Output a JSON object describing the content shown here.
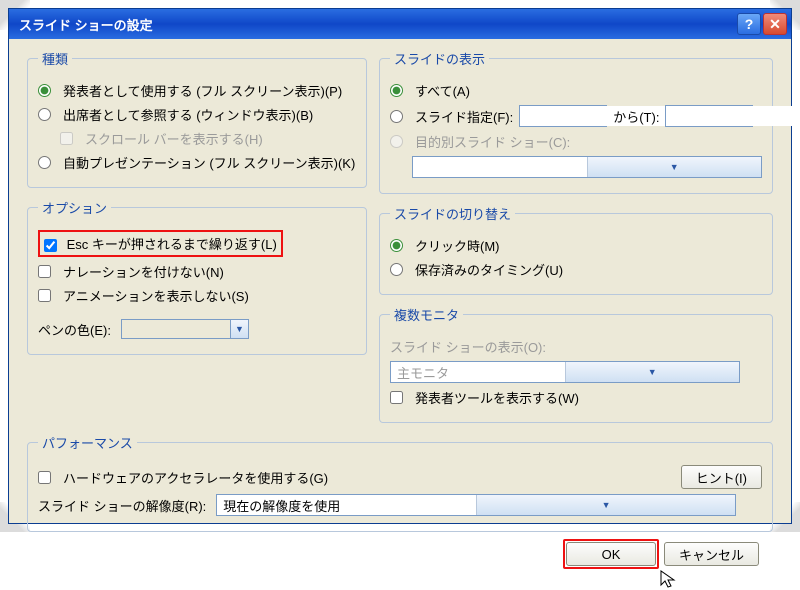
{
  "title": "スライド ショーの設定",
  "type_group": {
    "legend": "種類",
    "presenter": "発表者として使用する (フル スクリーン表示)(P)",
    "attendee": "出席者として参照する (ウィンドウ表示)(B)",
    "scroll": "スクロール バーを表示する(H)",
    "auto": "自動プレゼンテーション (フル スクリーン表示)(K)"
  },
  "options_group": {
    "legend": "オプション",
    "loop": "Esc キーが押されるまで繰り返す(L)",
    "no_narration": "ナレーションを付けない(N)",
    "no_animation": "アニメーションを表示しない(S)",
    "pen_color_label": "ペンの色(E):"
  },
  "slides_group": {
    "legend": "スライドの表示",
    "all": "すべて(A)",
    "range": "スライド指定(F):",
    "from_value": "",
    "to_label": "から(T):",
    "to_value": "",
    "custom": "目的別スライド ショー(C):",
    "custom_value": ""
  },
  "advance_group": {
    "legend": "スライドの切り替え",
    "manual": "クリック時(M)",
    "timings": "保存済みのタイミング(U)"
  },
  "monitors_group": {
    "legend": "複数モニタ",
    "display_label": "スライド ショーの表示(O):",
    "display_value": "主モニタ",
    "presenter_tools": "発表者ツールを表示する(W)"
  },
  "performance_group": {
    "legend": "パフォーマンス",
    "hw_accel": "ハードウェアのアクセラレータを使用する(G)",
    "hint": "ヒント(I)",
    "res_label": "スライド ショーの解像度(R):",
    "res_value": "現在の解像度を使用"
  },
  "buttons": {
    "ok": "OK",
    "cancel": "キャンセル"
  }
}
